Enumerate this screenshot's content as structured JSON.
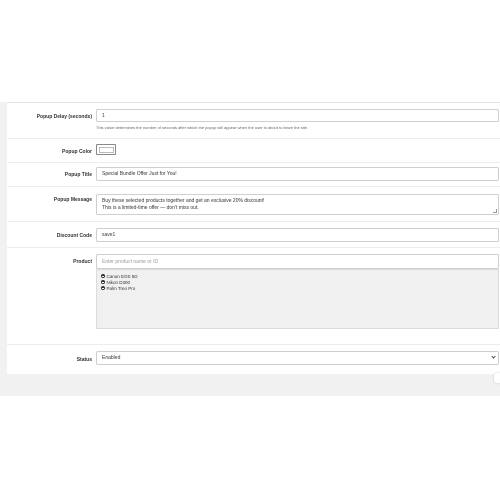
{
  "form": {
    "popup_delay": {
      "label": "Popup Delay (seconds)",
      "value": "1",
      "help": "This value determines the number of seconds after which the popup will appear when the user is about to leave the site."
    },
    "popup_color": {
      "label": "Popup Color",
      "value": "#ffffff"
    },
    "popup_title": {
      "label": "Popup Title",
      "value": "Special Bundle Offer Just for You!"
    },
    "popup_message": {
      "label": "Popup Message",
      "line1": "Buy these selected products together and get an exclusive 20% discount!",
      "line2": "This is a limited-time offer — don't miss out."
    },
    "discount_code": {
      "label": "Discount Code",
      "value": "save1"
    },
    "product": {
      "label": "Product",
      "placeholder": "Enter product name or ID",
      "items": [
        "Canon EOS 5D",
        "Nikon D300",
        "Palm Treo Pro"
      ]
    },
    "status": {
      "label": "Status",
      "value": "Enabled"
    }
  },
  "icons": {
    "remove": "minus-circle-icon",
    "select": "chevron-down-icon"
  }
}
